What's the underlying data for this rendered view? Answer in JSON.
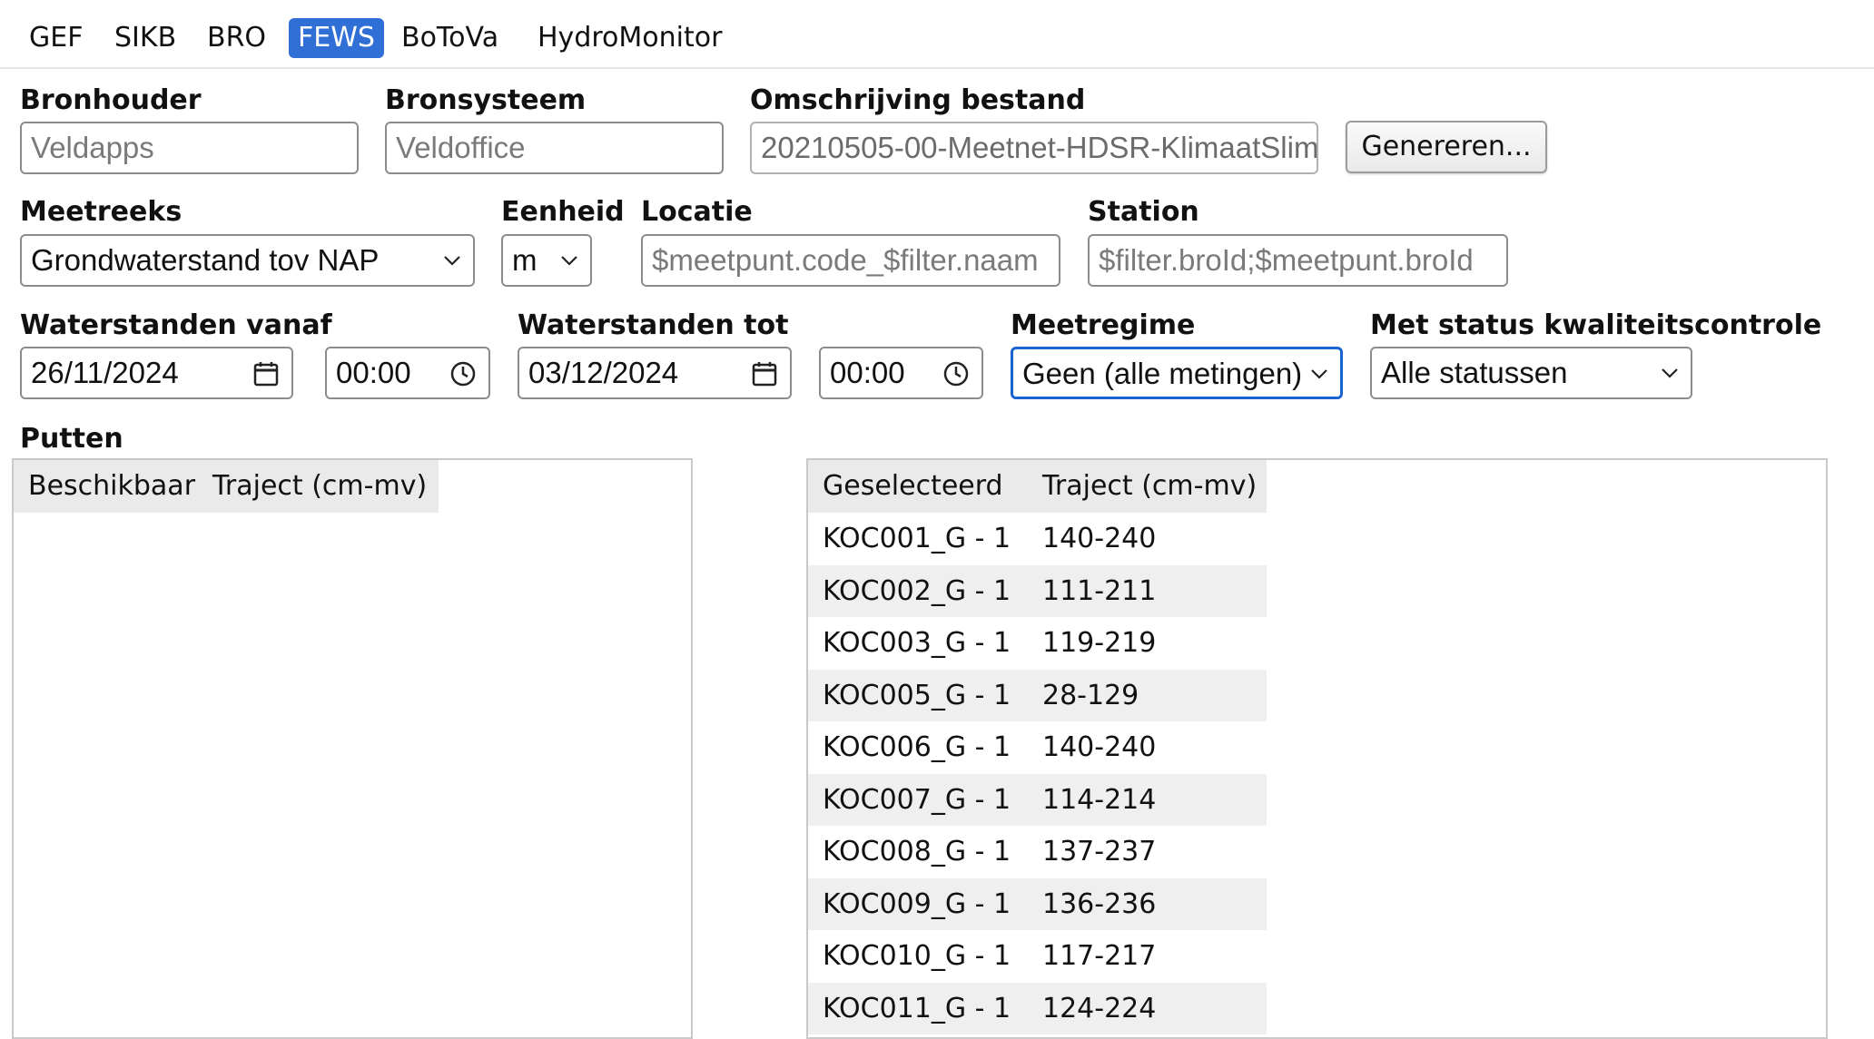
{
  "tabs": [
    "GEF",
    "SIKB",
    "BRO",
    "FEWS",
    "BoToVa",
    "HydroMonitor"
  ],
  "active_tab": "FEWS",
  "form": {
    "bronhouder": {
      "label": "Bronhouder",
      "placeholder": "Veldapps"
    },
    "bronsysteem": {
      "label": "Bronsysteem",
      "placeholder": "Veldoffice"
    },
    "omschrijving": {
      "label": "Omschrijving bestand",
      "value": "20210505-00-Meetnet-HDSR-KlimaatSlim"
    },
    "genereren_button": "Genereren...",
    "meetreeks": {
      "label": "Meetreeks",
      "value": "Grondwaterstand tov NAP"
    },
    "eenheid": {
      "label": "Eenheid",
      "value": "m"
    },
    "locatie": {
      "label": "Locatie",
      "placeholder": "$meetpunt.code_$filter.naam"
    },
    "station": {
      "label": "Station",
      "placeholder": "$filter.broId;$meetpunt.broId"
    },
    "vanaf": {
      "label": "Waterstanden vanaf",
      "date": "26/11/2024",
      "time": "00:00"
    },
    "tot": {
      "label": "Waterstanden tot",
      "date": "03/12/2024",
      "time": "00:00"
    },
    "meetregime": {
      "label": "Meetregime",
      "value": "Geen (alle metingen)"
    },
    "kwaliteit": {
      "label": "Met status kwaliteitscontrole",
      "value": "Alle statussen"
    }
  },
  "putten": {
    "label": "Putten",
    "available": {
      "headers": [
        "Beschikbaar",
        "Traject (cm-mv)"
      ],
      "rows": []
    },
    "selected": {
      "headers": [
        "Geselecteerd",
        "Traject (cm-mv)"
      ],
      "rows": [
        {
          "name": "KOC001_G - 1",
          "traject": "140-240"
        },
        {
          "name": "KOC002_G - 1",
          "traject": "111-211"
        },
        {
          "name": "KOC003_G - 1",
          "traject": "119-219"
        },
        {
          "name": "KOC005_G - 1",
          "traject": "28-129"
        },
        {
          "name": "KOC006_G - 1",
          "traject": "140-240"
        },
        {
          "name": "KOC007_G - 1",
          "traject": "114-214"
        },
        {
          "name": "KOC008_G - 1",
          "traject": "137-237"
        },
        {
          "name": "KOC009_G - 1",
          "traject": "136-236"
        },
        {
          "name": "KOC010_G - 1",
          "traject": "117-217"
        },
        {
          "name": "KOC011_G - 1",
          "traject": "124-224"
        }
      ]
    }
  },
  "colors": {
    "accent": "#2f6fd6",
    "focus": "#1c64d1"
  }
}
